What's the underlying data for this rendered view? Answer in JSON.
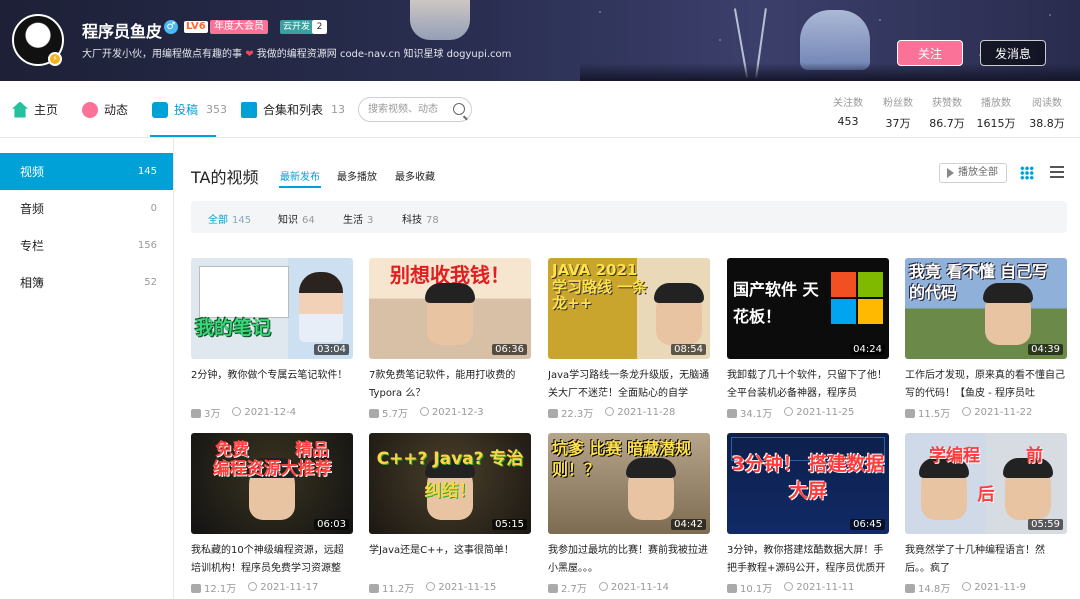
{
  "profile": {
    "name": "程序员鱼皮",
    "gender_icon": "male-icon",
    "level": "LV6",
    "vip": "年度大会员",
    "tag": "云开发",
    "tag_num": "2",
    "sign_part1": "大厂开发小伙，用编程做点有趣的事",
    "sign_part2": "我做的编程资源网 code-nav.cn 知识星球 dogyupi.com",
    "follow_label": "关注",
    "message_label": "发消息"
  },
  "nav": {
    "home": "主页",
    "dynamic": "动态",
    "uploads": "投稿",
    "uploads_count": "353",
    "collections": "合集和列表",
    "collections_count": "13",
    "search_placeholder": "搜索视频、动态"
  },
  "stats": [
    {
      "label": "关注数",
      "value": "453"
    },
    {
      "label": "粉丝数",
      "value": "37万"
    },
    {
      "label": "获赞数",
      "value": "86.7万"
    },
    {
      "label": "播放数",
      "value": "1615万"
    },
    {
      "label": "阅读数",
      "value": "38.8万"
    }
  ],
  "sidebar": [
    {
      "label": "视频",
      "count": "145"
    },
    {
      "label": "音频",
      "count": "0"
    },
    {
      "label": "专栏",
      "count": "156"
    },
    {
      "label": "相簿",
      "count": "52"
    }
  ],
  "main": {
    "title": "TA的视频",
    "sort": [
      "最新发布",
      "最多播放",
      "最多收藏"
    ],
    "play_all": "播放全部",
    "tags": [
      {
        "label": "全部",
        "count": "145"
      },
      {
        "label": "知识",
        "count": "64"
      },
      {
        "label": "生活",
        "count": "3"
      },
      {
        "label": "科技",
        "count": "78"
      }
    ]
  },
  "colors": {
    "accent": "#00a1d6",
    "pink": "#fb7299"
  },
  "videos": [
    {
      "caption": "我的笔记",
      "duration": "03:04",
      "title": "2分钟，教你做个专属云笔记软件！",
      "plays": "3万",
      "date": "2021-12-4"
    },
    {
      "caption": "别想收我钱！",
      "duration": "06:36",
      "title": "7款免费笔记软件，能用打收费的 Typora 么？",
      "plays": "5.7万",
      "date": "2021-12-3"
    },
    {
      "caption": "JAVA 2021 学习路线 一条龙++",
      "duration": "08:54",
      "title": "Java学习路线一条龙升级版，无脑通关大厂不迷茫！全面贴心的自学",
      "plays": "22.3万",
      "date": "2021-11-28"
    },
    {
      "caption": "国产软件 天花板！",
      "duration": "04:24",
      "title": "我卸载了几十个软件，只留下了他！全平台装机必备神器，程序员",
      "plays": "34.1万",
      "date": "2021-11-25"
    },
    {
      "caption": "我竟 看不懂 自己写的代码",
      "duration": "04:39",
      "title": "工作后才发现，原来真的看不懂自己写的代码！【鱼皮 - 程序员吐",
      "plays": "11.5万",
      "date": "2021-11-22"
    },
    {
      "caption": "免费 精品 编程资源大推荐",
      "duration": "06:03",
      "title": "我私藏的10个神级编程资源，远超培训机构！程序员免费学习资源整",
      "plays": "12.1万",
      "date": "2021-11-17"
    },
    {
      "caption": "C++? Java? 专治纠结！",
      "duration": "05:15",
      "title": "学Java还是C++，这事很简单！",
      "plays": "11.2万",
      "date": "2021-11-15"
    },
    {
      "caption": "坑爹 比赛 暗藏潜规则！？",
      "duration": "04:42",
      "title": "我参加过最坑的比赛！赛前我被拉进小黑屋。。。",
      "plays": "2.7万",
      "date": "2021-11-14"
    },
    {
      "caption": "3分钟！ 搭建数据大屏",
      "duration": "06:45",
      "title": "3分钟，教你搭建炫酷数据大屏！手把手教程+源码公开，程序员优质开",
      "plays": "10.1万",
      "date": "2021-11-11"
    },
    {
      "caption": "学编程 前 后",
      "duration": "05:59",
      "title": "我竟然学了十几种编程语言！然后。。疯了",
      "plays": "14.8万",
      "date": "2021-11-9"
    }
  ]
}
